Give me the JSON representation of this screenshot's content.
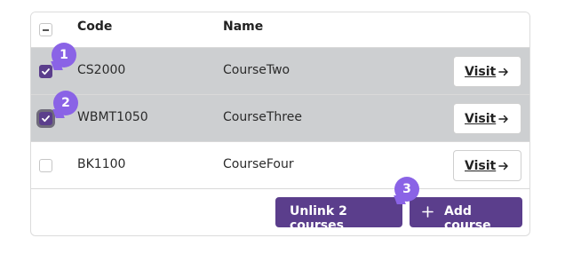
{
  "table": {
    "headers": {
      "code": "Code",
      "name": "Name"
    },
    "rows": [
      {
        "code": "CS2000",
        "name": "CourseTwo",
        "selected": true,
        "visit_label": "Visit"
      },
      {
        "code": "WBMT1050",
        "name": "CourseThree",
        "selected": true,
        "visit_label": "Visit"
      },
      {
        "code": "BK1100",
        "name": "CourseFour",
        "selected": false,
        "visit_label": "Visit"
      }
    ]
  },
  "actions": {
    "unlink_label": "Unlink 2 courses",
    "add_label": "Add course"
  },
  "step_badges": [
    "1",
    "2",
    "3"
  ],
  "colors": {
    "primary": "#5b3e8c",
    "badge": "#8a63e6",
    "selected_row": "#cdcfd1"
  }
}
